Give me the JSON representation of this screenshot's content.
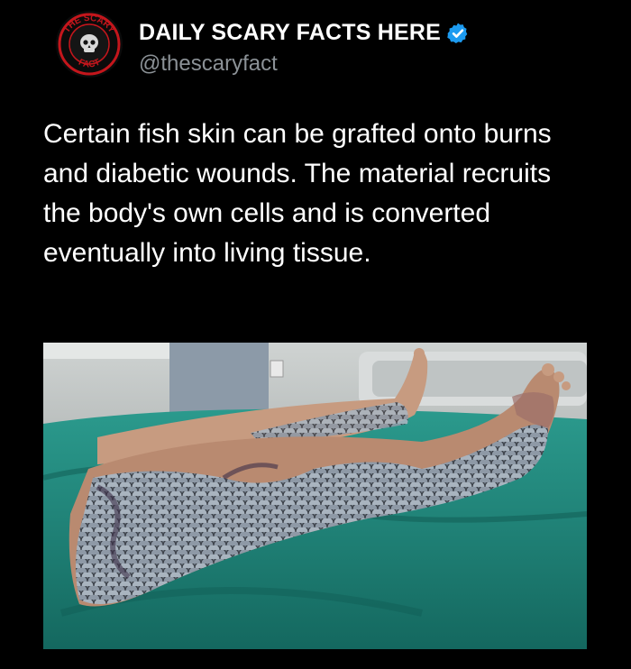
{
  "account": {
    "display_name": "DAILY SCARY FACTS HERE",
    "handle": "@thescaryfact",
    "verified": true,
    "avatar_icon": "the-scary-fact-logo-icon",
    "avatar_text_top": "THE SCARY",
    "avatar_text_bottom": "FACT",
    "verified_color": "#1d9bf0"
  },
  "tweet": {
    "text": "Certain fish skin can be grafted onto burns and diabetic wounds. The material recruits the body's own cells and is converted eventually into living tissue."
  },
  "media": {
    "icon": "fish-skin-graft-legs-photo"
  },
  "colors": {
    "background": "#000000",
    "text": "#ffffff",
    "secondary_text": "#8b9196",
    "accent_red": "#c4161c"
  }
}
